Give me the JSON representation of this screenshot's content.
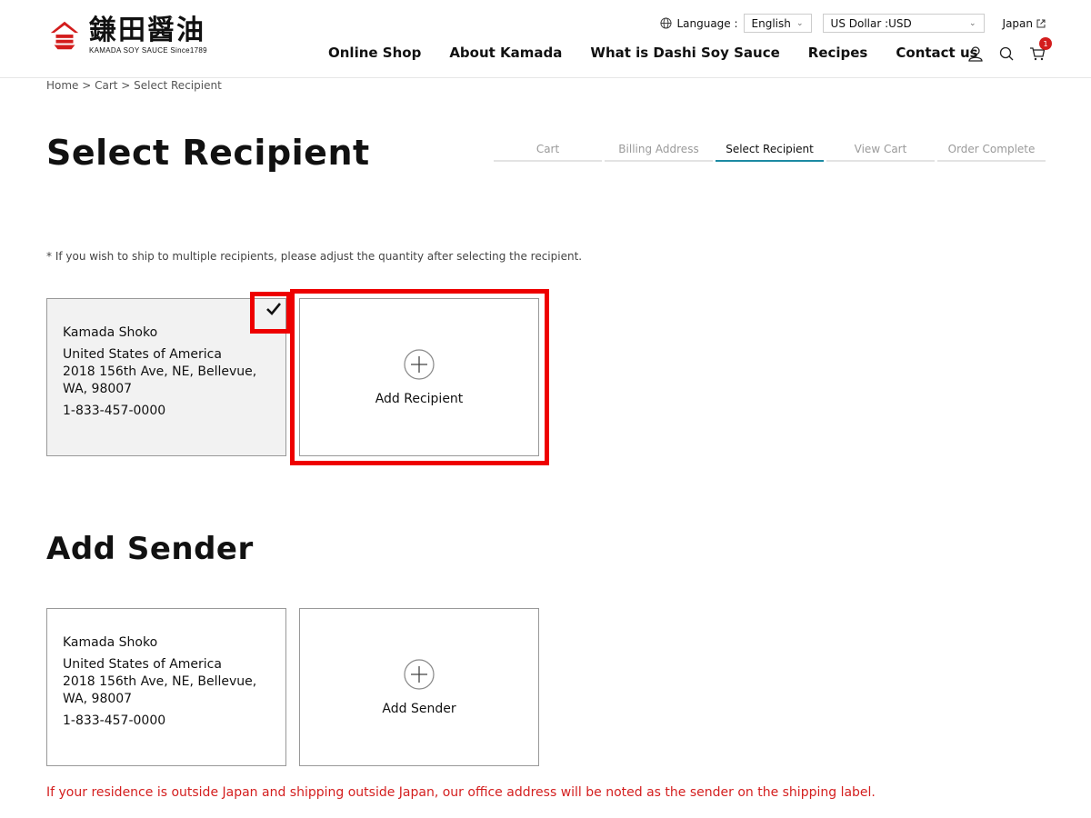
{
  "header": {
    "logo_jp": "鎌田醤油",
    "logo_en": "KAMADA SOY SAUCE Since1789",
    "language_label": "Language :",
    "language_value": "English",
    "currency_value": "US Dollar :USD",
    "japan_link": "Japan",
    "nav": [
      "Online Shop",
      "About Kamada",
      "What is Dashi Soy Sauce",
      "Recipes",
      "Contact us"
    ],
    "cart_count": "1"
  },
  "breadcrumb": "Home > Cart > Select Recipient",
  "page_title": "Select Recipient",
  "steps": [
    "Cart",
    "Billing Address",
    "Select Recipient",
    "View Cart",
    "Order Complete"
  ],
  "active_step": "Select Recipient",
  "note": "* If you wish to ship to multiple recipients, please adjust the quantity after selecting the recipient.",
  "recipient": {
    "name": "Kamada Shoko",
    "country": "United States of America",
    "address": "2018 156th Ave, NE, Bellevue, WA, 98007",
    "phone": "1-833-457-0000",
    "selected": true
  },
  "add_recipient_label": "Add Recipient",
  "sender_section_title": "Add Sender",
  "sender": {
    "name": "Kamada Shoko",
    "country": "United States of America",
    "address": "2018 156th Ave, NE, Bellevue, WA, 98007",
    "phone": "1-833-457-0000"
  },
  "add_sender_label": "Add Sender",
  "footer_note": "If your residence is outside Japan and shipping outside Japan, our office address will be noted as the sender on the shipping label.",
  "colors": {
    "accent": "#1c8aa3",
    "alert": "#d41f1f",
    "highlight": "#ee0000"
  }
}
